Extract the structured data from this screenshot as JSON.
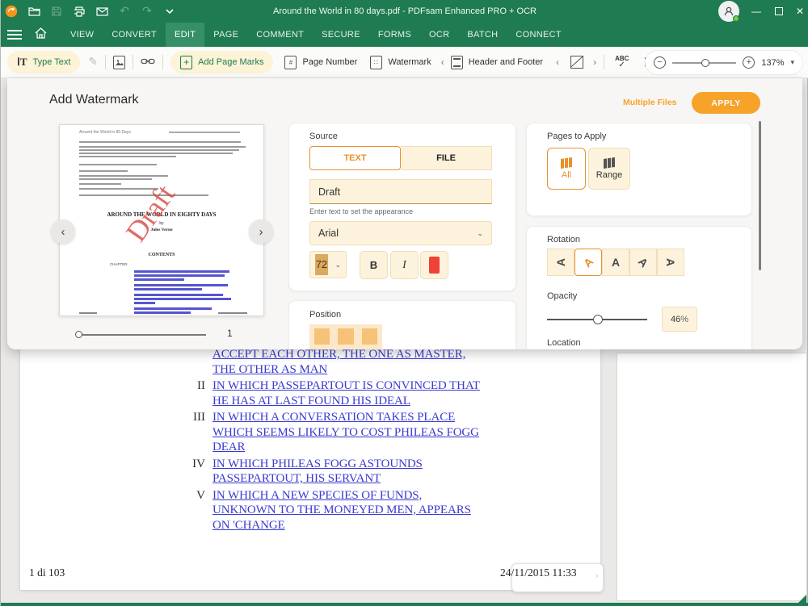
{
  "colors": {
    "brand_green": "#1e7b52",
    "accent_orange": "#f7a229",
    "control_cream": "#fdf3dc",
    "swatch_red": "#ef4136",
    "link_blue": "#3a3ad0"
  },
  "titlebar": {
    "title": "Around the World in 80 days.pdf  -  PDFsam Enhanced PRO + OCR"
  },
  "menu": {
    "items": [
      "VIEW",
      "CONVERT",
      "EDIT",
      "PAGE",
      "COMMENT",
      "SECURE",
      "FORMS",
      "OCR",
      "BATCH",
      "CONNECT"
    ],
    "active": "EDIT"
  },
  "toolbar": {
    "type_text": "Type Text",
    "add_page_marks": "Add Page Marks",
    "page_number": "Page Number",
    "watermark": "Watermark",
    "header_and_footer": "Header and Footer",
    "spellcheck": "ABC",
    "spellcheck_check": "✓",
    "zoom_level": "137%"
  },
  "dialog": {
    "title": "Add Watermark",
    "multiple_files_label": "Multiple Files",
    "apply_label": "APPLY",
    "preview": {
      "doc_header": "Around the World in 80 Days",
      "doc_title": "AROUND THE WORLD IN EIGHTY DAYS",
      "doc_by": "by",
      "doc_author": "Jules Verne",
      "doc_contents": "CONTENTS",
      "doc_chapter": "CHAPTER",
      "watermark_text": "Draft",
      "page_indicator": "1"
    },
    "source": {
      "label": "Source",
      "tab_text": "TEXT",
      "tab_file": "FILE",
      "text_value": "Draft",
      "helper": "Enter text to set the appearance",
      "font_family": "Arial",
      "font_size": "72",
      "bold_label": "B",
      "italic_label": "I"
    },
    "position": {
      "label": "Position"
    },
    "pages_to_apply": {
      "label": "Pages to Apply",
      "all_label": "All",
      "range_label": "Range"
    },
    "rotation": {
      "label": "Rotation",
      "glyph": "A"
    },
    "opacity": {
      "label": "Opacity",
      "value": "46",
      "unit": "%"
    },
    "location": {
      "label": "Location"
    }
  },
  "document": {
    "chapters": [
      {
        "numeral": "",
        "lines": [
          "ACCEPT EACH OTHER, THE ONE AS MASTER,",
          "THE OTHER AS MAN"
        ]
      },
      {
        "numeral": "II",
        "lines": [
          "IN WHICH PASSEPARTOUT IS CONVINCED THAT",
          "HE HAS AT LAST FOUND HIS IDEAL"
        ]
      },
      {
        "numeral": "III",
        "lines": [
          "IN WHICH A CONVERSATION TAKES PLACE",
          "WHICH SEEMS LIKELY TO COST PHILEAS FOGG",
          "DEAR"
        ]
      },
      {
        "numeral": "IV",
        "lines": [
          "IN WHICH PHILEAS FOGG ASTOUNDS",
          "PASSEPARTOUT, HIS SERVANT"
        ]
      },
      {
        "numeral": "V",
        "lines": [
          "IN WHICH A NEW SPECIES OF FUNDS,",
          "UNKNOWN TO THE MONEYED MEN, APPEARS",
          "ON 'CHANGE"
        ]
      }
    ],
    "page_info": "1 di 103",
    "timestamp": "24/11/2015 11:33"
  }
}
